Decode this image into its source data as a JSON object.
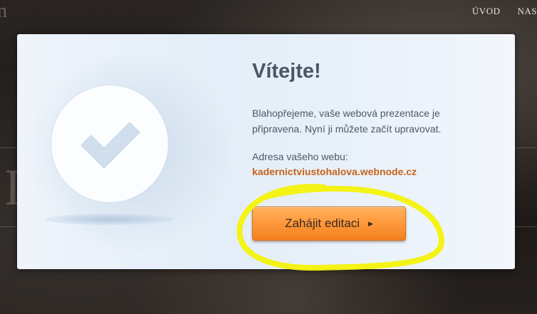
{
  "background": {
    "partial_letter": "n",
    "nav": [
      {
        "label": "ÚVOD"
      },
      {
        "label": "NAS"
      }
    ],
    "big_letter": "I"
  },
  "modal": {
    "icon": "checkmark-circle-icon",
    "title": "Vítejte!",
    "message": "Blahopřejeme, vaše webová prezentace je připravena. Nyní ji můžete začít upravovat.",
    "address_label": "Adresa vašeho webu:",
    "address_url": "kadernictviustohalova.webnode.cz",
    "start_button": {
      "label": "Zahájit editaci",
      "arrow_icon": "triangle-right-icon"
    }
  },
  "colors": {
    "accent_orange": "#ff9a3e",
    "link_orange": "#c8631a",
    "highlight_yellow": "#f4f20a",
    "title_gray": "#4a5565"
  }
}
